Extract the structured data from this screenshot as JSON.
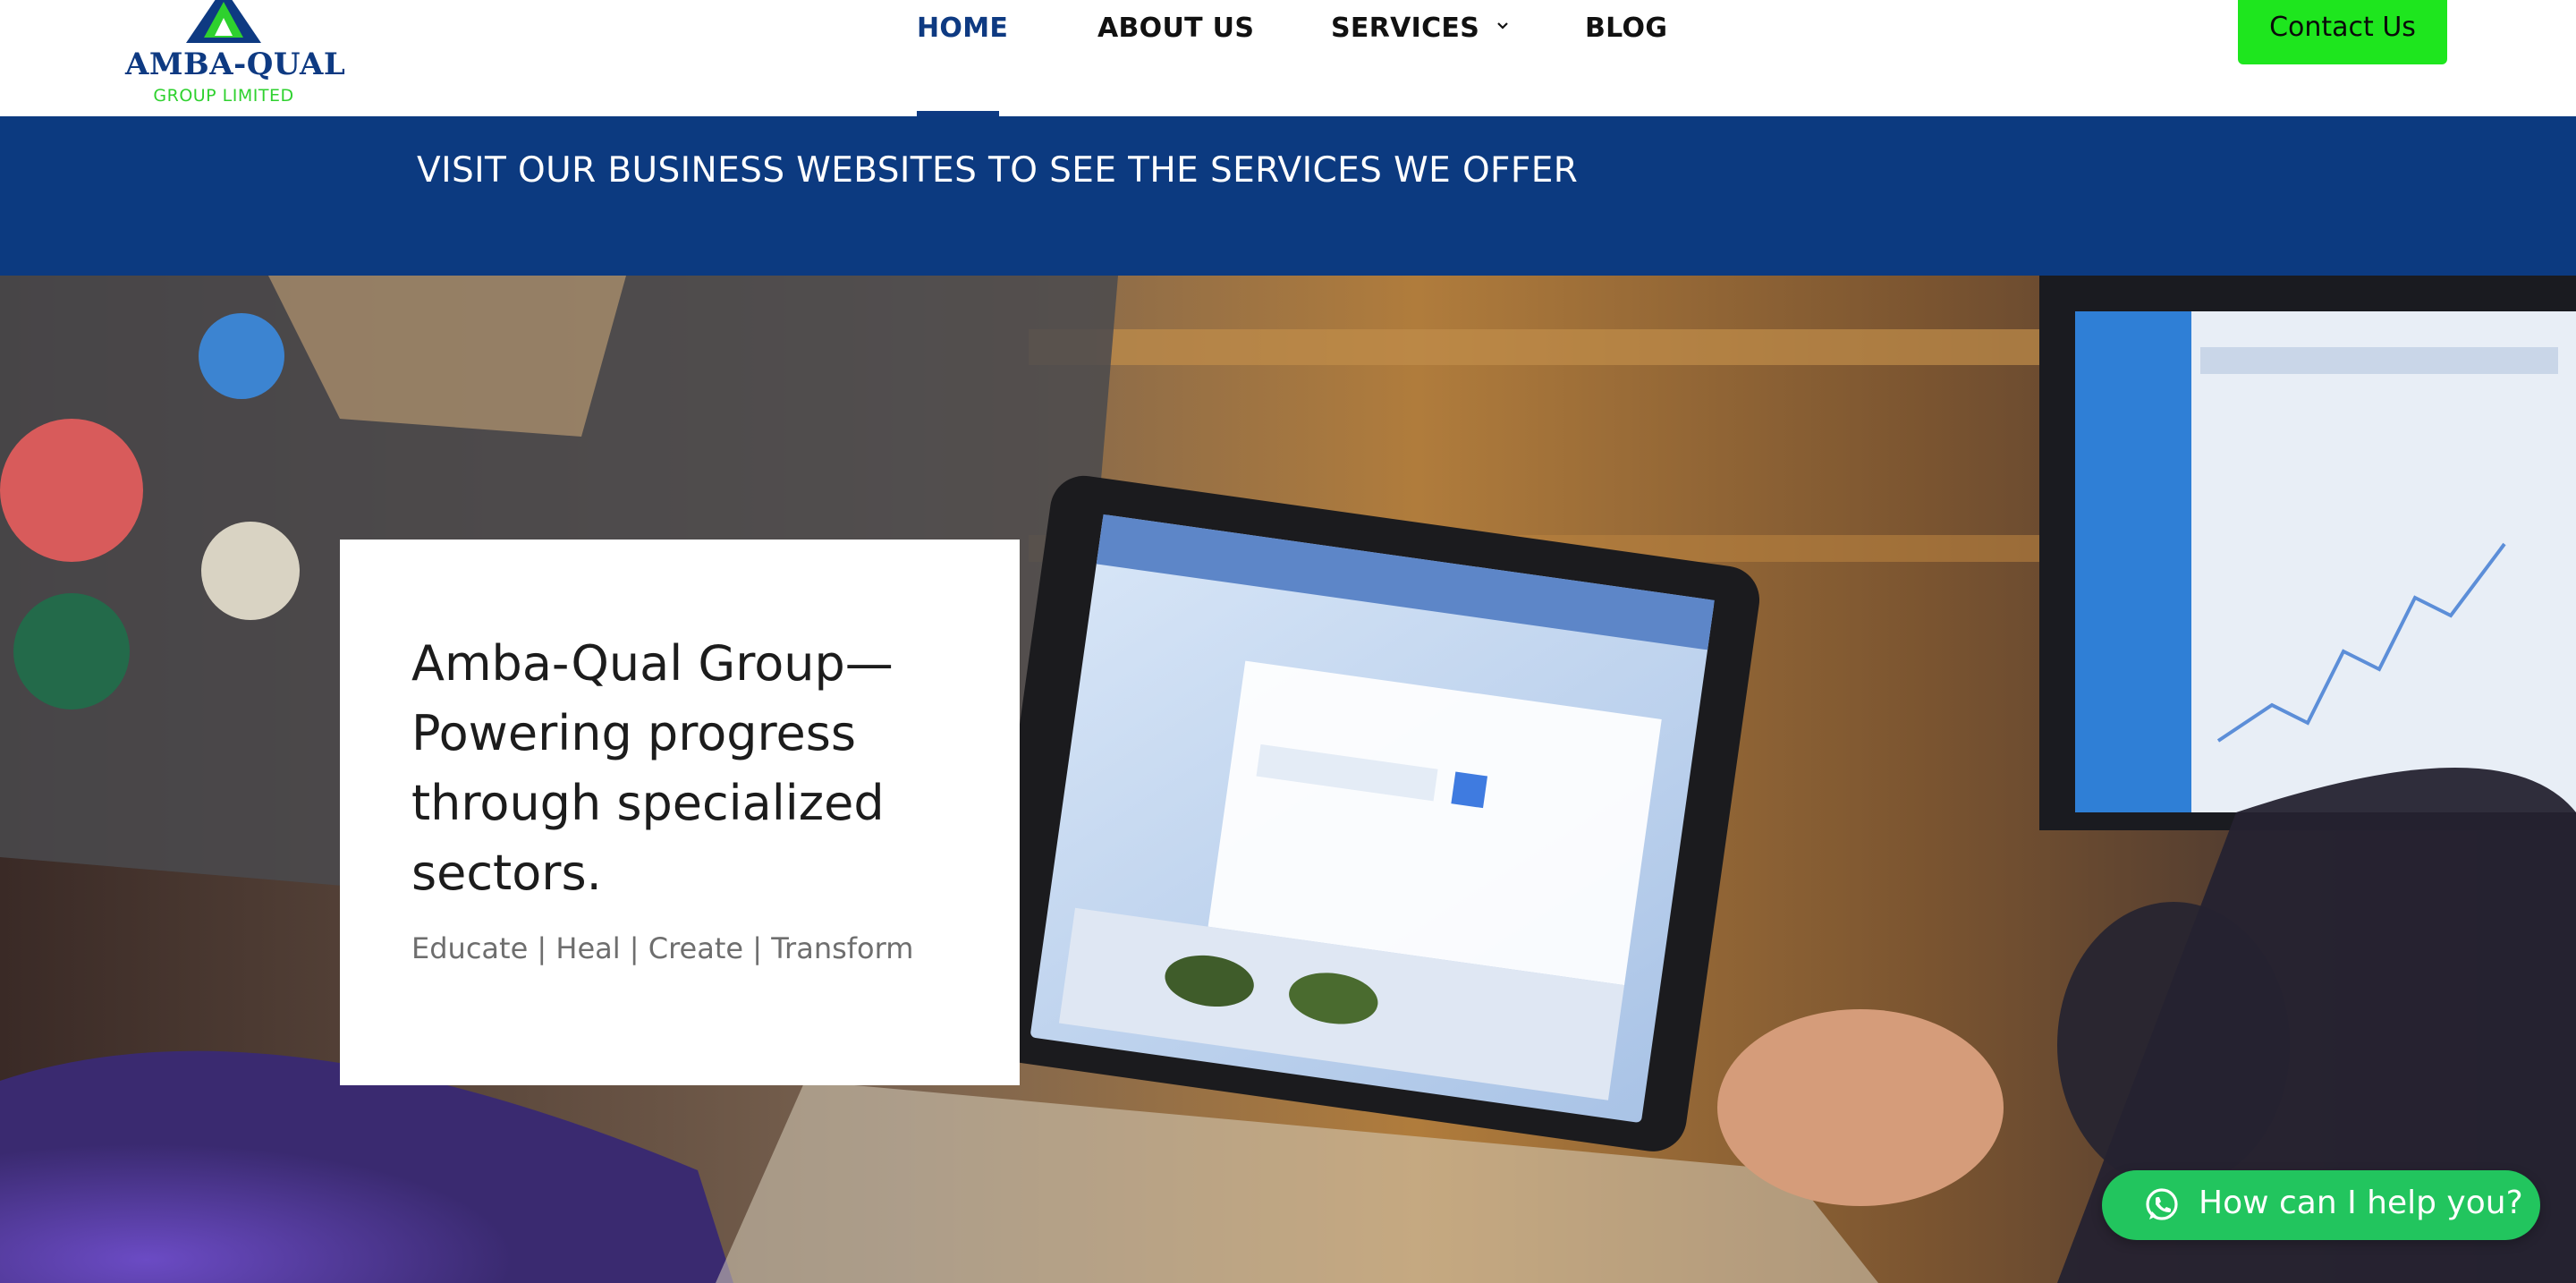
{
  "brand": {
    "name": "AMBA-QUAL",
    "subtitle": "GROUP LIMITED"
  },
  "nav": {
    "items": [
      {
        "label": "HOME",
        "active": true
      },
      {
        "label": "ABOUT US",
        "active": false
      },
      {
        "label": "SERVICES",
        "active": false,
        "has_dropdown": true
      },
      {
        "label": "BLOG",
        "active": false
      }
    ],
    "contact_label": "Contact Us"
  },
  "banner": {
    "text": "VISIT OUR BUSINESS WEBSITES TO SEE THE SERVICES WE OFFER"
  },
  "hero": {
    "title": "Amba-Qual Group—Powering progress through specialized sectors.",
    "tagline": "Educate | Heal | Create | Transform"
  },
  "chat": {
    "label": "How can I help you?"
  },
  "colors": {
    "brand_blue": "#0c3a80",
    "brand_green": "#1ee61e",
    "chat_green": "#22c55e"
  },
  "icons": {
    "dropdown": "chevron-down-icon",
    "chat": "whatsapp-icon"
  }
}
